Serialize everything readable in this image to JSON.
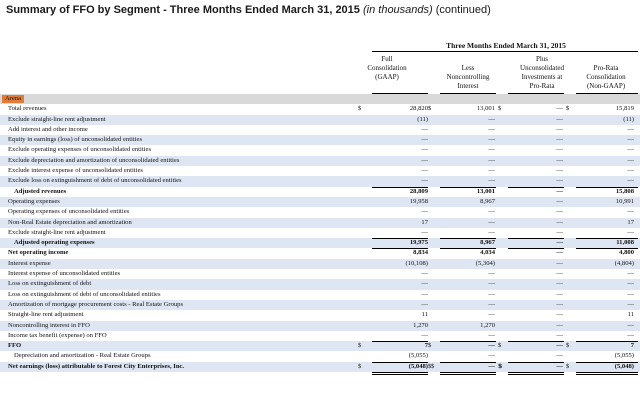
{
  "title": {
    "main": "Summary of FFO by Segment - Three Months Ended March 31, 2015",
    "italic": "(in thousands)",
    "suffix": "(continued)"
  },
  "period_header": "Three Months Ended March 31, 2015",
  "columns": [
    {
      "label": "Full\nConsolidation\n(GAAP)"
    },
    {
      "label": "Less\nNoncontrolling\nInterest"
    },
    {
      "label": "Plus\nUnconsolidated\nInvestments at\nPro-Rata"
    },
    {
      "label": "Pro-Rata\nConsolidation\n(Non-GAAP)"
    }
  ],
  "section": "Arena",
  "rows": [
    {
      "label": "Total revenues",
      "v": [
        "28,820",
        "13,001",
        "—",
        "15,819"
      ],
      "cur": [
        "$",
        "$",
        "$",
        "$"
      ],
      "style": ""
    },
    {
      "label": "Exclude straight-line rent adjustment",
      "v": [
        "(11)",
        "—",
        "—",
        "(11)"
      ],
      "style": "alt"
    },
    {
      "label": "Add interest and other income",
      "v": [
        "—",
        "—",
        "—",
        "—"
      ],
      "style": ""
    },
    {
      "label": "Equity in earnings (loss) of unconsolidated entities",
      "v": [
        "—",
        "—",
        "—",
        "—"
      ],
      "style": "alt"
    },
    {
      "label": "Exclude operating expenses of unconsolidated entities",
      "v": [
        "—",
        "—",
        "—",
        "—"
      ],
      "style": ""
    },
    {
      "label": "Exclude depreciation and amortization of unconsolidated entities",
      "v": [
        "—",
        "—",
        "—",
        "—"
      ],
      "style": "alt"
    },
    {
      "label": "Exclude interest expense of unconsolidated entities",
      "v": [
        "—",
        "—",
        "—",
        "—"
      ],
      "style": ""
    },
    {
      "label": "Exclude loss on extinguishment of debt of unconsolidated entities",
      "v": [
        "—",
        "—",
        "—",
        "—"
      ],
      "style": "alt"
    },
    {
      "label": "Adjusted revenues",
      "v": [
        "28,809",
        "13,001",
        "—",
        "15,808"
      ],
      "style": "bold indent"
    },
    {
      "label": "Operating expenses",
      "v": [
        "19,958",
        "8,967",
        "—",
        "10,991"
      ],
      "style": "alt"
    },
    {
      "label": "Operating expenses of unconsolidated entities",
      "v": [
        "—",
        "—",
        "—",
        "—"
      ],
      "style": ""
    },
    {
      "label": "Non-Real Estate depreciation and amortization",
      "v": [
        "17",
        "—",
        "—",
        "17"
      ],
      "style": "alt"
    },
    {
      "label": "Exclude straight-line rent adjustment",
      "v": [
        "—",
        "—",
        "—",
        "—"
      ],
      "style": ""
    },
    {
      "label": "Adjusted operating expenses",
      "v": [
        "19,975",
        "8,967",
        "—",
        "11,008"
      ],
      "style": "alt bold indent"
    },
    {
      "label": "Net operating income",
      "v": [
        "8,834",
        "4,034",
        "—",
        "4,800"
      ],
      "style": "bold"
    },
    {
      "label": "Interest expense",
      "v": [
        "(10,108)",
        "(5,304)",
        "—",
        "(4,804)"
      ],
      "style": "alt"
    },
    {
      "label": "Interest expense of unconsolidated entities",
      "v": [
        "—",
        "—",
        "—",
        "—"
      ],
      "style": ""
    },
    {
      "label": "Loss on extinguishment of debt",
      "v": [
        "—",
        "—",
        "—",
        "—"
      ],
      "style": "alt"
    },
    {
      "label": "Loss on extinguishment of debt of unconsolidated entities",
      "v": [
        "—",
        "—",
        "—",
        "—"
      ],
      "style": ""
    },
    {
      "label": "Amortization of mortgage procurement costs - Real Estate Groups",
      "v": [
        "—",
        "—",
        "—",
        "—"
      ],
      "style": "alt"
    },
    {
      "label": "Straight-line rent adjustment",
      "v": [
        "11",
        "—",
        "—",
        "11"
      ],
      "style": ""
    },
    {
      "label": "Noncontrolling interest in FFO",
      "v": [
        "1,270",
        "1,270",
        "—",
        "—"
      ],
      "style": "alt"
    },
    {
      "label": "Income tax benefit (expense) on FFO",
      "v": [
        "—",
        "—",
        "—",
        "—"
      ],
      "style": ""
    },
    {
      "label": "FFO",
      "v": [
        "7",
        "—",
        "—",
        "7"
      ],
      "cur": [
        "$",
        "$",
        "$",
        "$"
      ],
      "style": "alt bold"
    },
    {
      "label": "Depreciation and amortization - Real Estate Groups",
      "v": [
        "(5,055)",
        "—",
        "—",
        "(5,055)"
      ],
      "style": "indent"
    },
    {
      "label": "Net earnings (loss) attributable to Forest City Enterprises, Inc.",
      "v": [
        "(5,048)",
        "—",
        "—",
        "(5,048)"
      ],
      "cur": [
        "$",
        "$",
        "$",
        "$"
      ],
      "suffix": [
        "$",
        "$",
        "",
        ""
      ],
      "style": "alt bold"
    }
  ]
}
